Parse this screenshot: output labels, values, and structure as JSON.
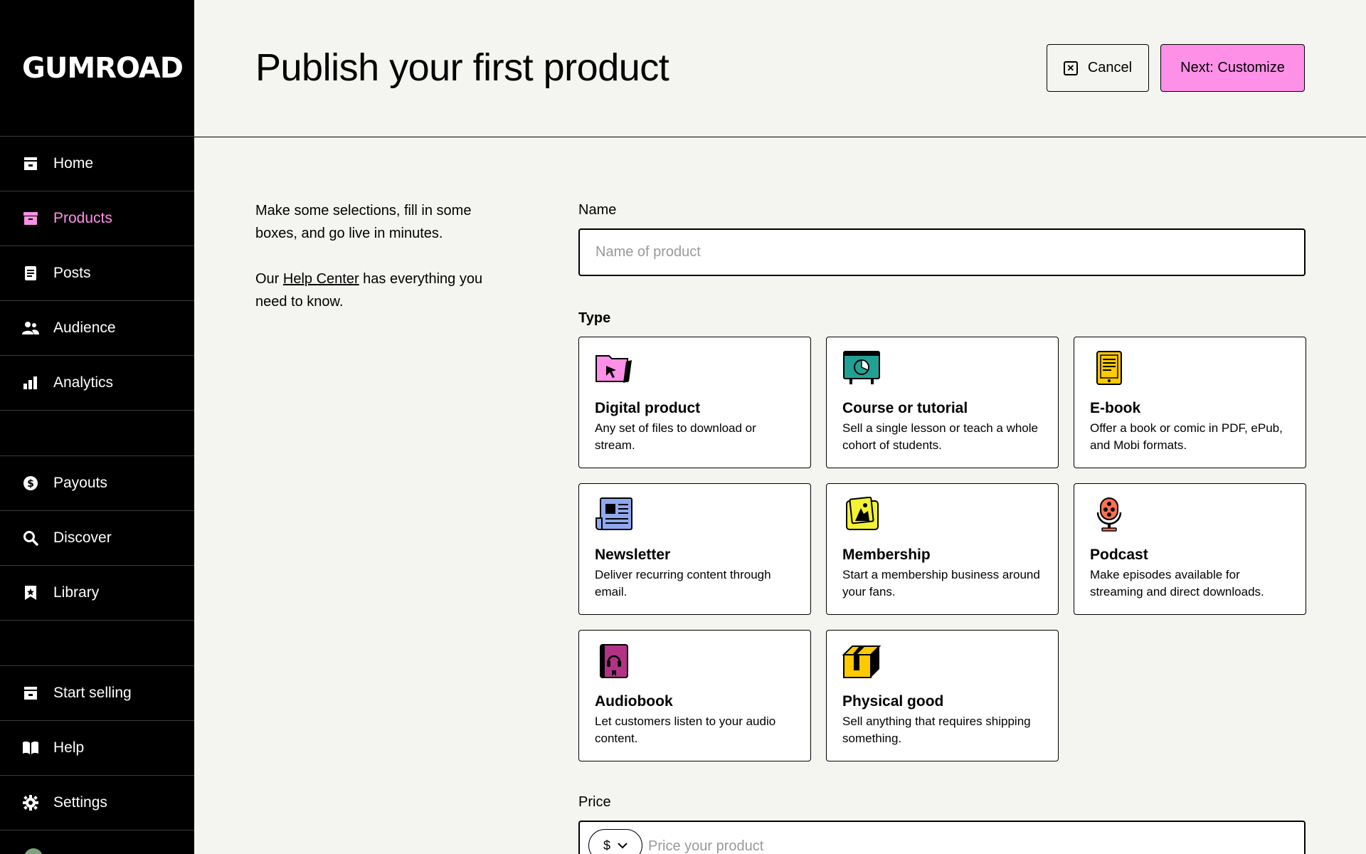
{
  "brand": {
    "logo_text": "GUMROAD"
  },
  "sidebar": {
    "items": [
      {
        "label": "Home",
        "icon": "store-icon"
      },
      {
        "label": "Products",
        "icon": "archive-icon",
        "active": true
      },
      {
        "label": "Posts",
        "icon": "document-icon"
      },
      {
        "label": "Audience",
        "icon": "people-icon"
      },
      {
        "label": "Analytics",
        "icon": "bar-chart-icon"
      }
    ],
    "items2": [
      {
        "label": "Payouts",
        "icon": "dollar-icon"
      },
      {
        "label": "Discover",
        "icon": "search-icon"
      },
      {
        "label": "Library",
        "icon": "bookmark-icon"
      }
    ],
    "items3": [
      {
        "label": "Start selling",
        "icon": "store-icon"
      },
      {
        "label": "Help",
        "icon": "book-icon"
      },
      {
        "label": "Settings",
        "icon": "gear-icon"
      }
    ]
  },
  "header": {
    "title": "Publish your first product",
    "cancel_label": "Cancel",
    "next_label": "Next: Customize"
  },
  "intro": {
    "line1": "Make some selections, fill in some boxes, and go live in minutes.",
    "line2_before": "Our ",
    "link": "Help Center",
    "line2_after": " has everything you need to know."
  },
  "form": {
    "name_label": "Name",
    "name_placeholder": "Name of product",
    "type_label": "Type",
    "price_label": "Price",
    "currency": "$",
    "price_placeholder": "Price your product"
  },
  "types": [
    {
      "title": "Digital product",
      "desc": "Any set of files to download or stream.",
      "icon": "digital-product-icon",
      "color": "#ff90e8"
    },
    {
      "title": "Course or tutorial",
      "desc": "Sell a single lesson or teach a whole cohort of students.",
      "icon": "course-icon",
      "color": "#23a094"
    },
    {
      "title": "E-book",
      "desc": "Offer a book or comic in PDF, ePub, and Mobi formats.",
      "icon": "ebook-icon",
      "color": "#ffc900"
    },
    {
      "title": "Newsletter",
      "desc": "Deliver recurring content through email.",
      "icon": "newsletter-icon",
      "color": "#90a8ed"
    },
    {
      "title": "Membership",
      "desc": "Start a membership business around your fans.",
      "icon": "membership-icon",
      "color": "#f1f333"
    },
    {
      "title": "Podcast",
      "desc": "Make episodes available for streaming and direct downloads.",
      "icon": "podcast-icon",
      "color": "#ff7051"
    },
    {
      "title": "Audiobook",
      "desc": "Let customers listen to your audio content.",
      "icon": "audiobook-icon",
      "color": "#b23386"
    },
    {
      "title": "Physical good",
      "desc": "Sell anything that requires shipping something.",
      "icon": "physical-good-icon",
      "color": "#ffc900"
    }
  ]
}
